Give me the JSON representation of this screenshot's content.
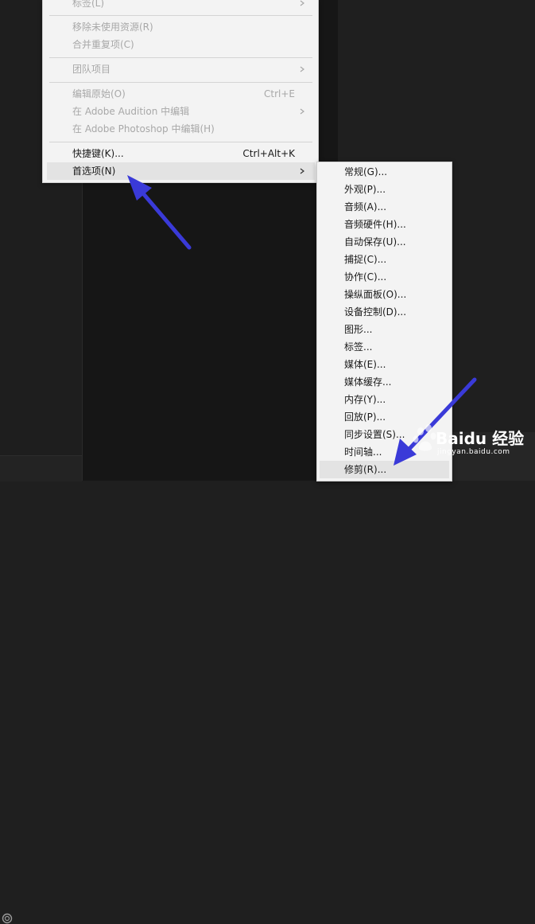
{
  "main_menu": {
    "items": [
      {
        "label": "标签(L)",
        "shortcut": "",
        "submenu": true,
        "disabled": true
      },
      {
        "label": "移除未使用资源(R)",
        "shortcut": "",
        "submenu": false,
        "disabled": true
      },
      {
        "label": "合并重复项(C)",
        "shortcut": "",
        "submenu": false,
        "disabled": true
      },
      {
        "label": "团队项目",
        "shortcut": "",
        "submenu": true,
        "disabled": true
      },
      {
        "label": "编辑原始(O)",
        "shortcut": "Ctrl+E",
        "submenu": false,
        "disabled": true
      },
      {
        "label": "在 Adobe Audition 中编辑",
        "shortcut": "",
        "submenu": true,
        "disabled": true
      },
      {
        "label": "在 Adobe Photoshop 中编辑(H)",
        "shortcut": "",
        "submenu": false,
        "disabled": true
      },
      {
        "label": "快捷键(K)...",
        "shortcut": "Ctrl+Alt+K",
        "submenu": false,
        "disabled": false
      },
      {
        "label": "首选项(N)",
        "shortcut": "",
        "submenu": true,
        "disabled": false,
        "highlighted": true
      }
    ]
  },
  "preferences_submenu": {
    "items": [
      {
        "label": "常规(G)..."
      },
      {
        "label": "外观(P)..."
      },
      {
        "label": "音频(A)..."
      },
      {
        "label": "音频硬件(H)..."
      },
      {
        "label": "自动保存(U)..."
      },
      {
        "label": "捕捉(C)..."
      },
      {
        "label": "协作(C)..."
      },
      {
        "label": "操纵面板(O)..."
      },
      {
        "label": "设备控制(D)..."
      },
      {
        "label": "图形..."
      },
      {
        "label": "标签..."
      },
      {
        "label": "媒体(E)..."
      },
      {
        "label": "媒体缓存..."
      },
      {
        "label": "内存(Y)..."
      },
      {
        "label": "回放(P)..."
      },
      {
        "label": "同步设置(S)..."
      },
      {
        "label": "时间轴..."
      },
      {
        "label": "修剪(R)...",
        "highlighted": true
      }
    ]
  },
  "watermark": {
    "brand": "Baidu 经验",
    "url": "jingyan.baidu.com"
  },
  "colors": {
    "annotation_arrow": "#3a3ad8",
    "menu_bg": "#f3f3f3",
    "app_bg": "#1f1f1f"
  }
}
